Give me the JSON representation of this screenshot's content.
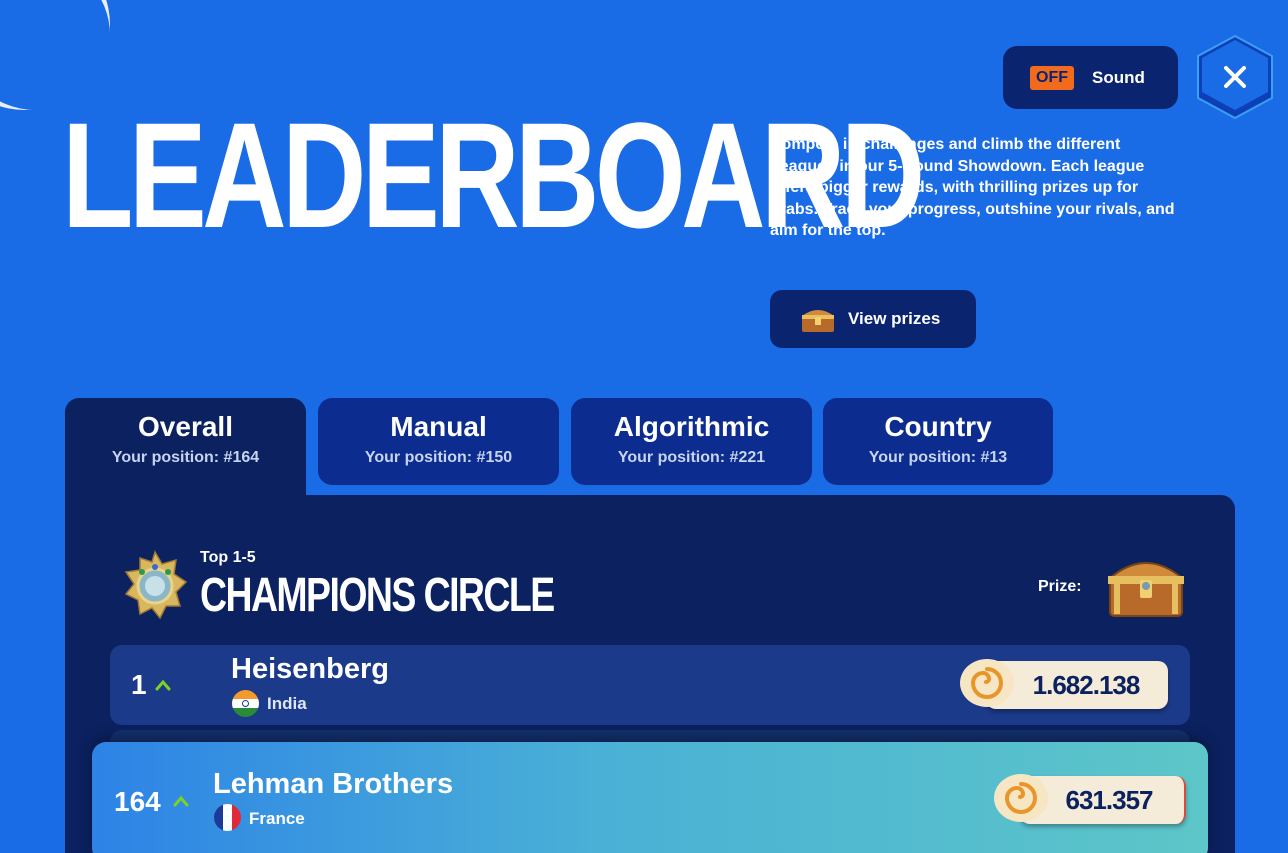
{
  "title": "LEADERBOARD",
  "sound": {
    "state": "OFF",
    "label": "Sound"
  },
  "description": "Compete in challenges and climb the different Leagues in our 5-Round Showdown. Each league offers bigger rewards, with thrilling prizes up for grabs. Track your progress, outshine your rivals, and aim for the top.",
  "prizes_button": "View prizes",
  "tabs": [
    {
      "title": "Overall",
      "sub": "Your position: #164"
    },
    {
      "title": "Manual",
      "sub": "Your position: #150"
    },
    {
      "title": "Algorithmic",
      "sub": "Your position: #221"
    },
    {
      "title": "Country",
      "sub": "Your position: #13"
    }
  ],
  "section": {
    "small": "Top 1-5",
    "title": "CHAMPIONS CIRCLE",
    "prize_label": "Prize:"
  },
  "rows": [
    {
      "rank": "1",
      "name": "Heisenberg",
      "country": "India",
      "score": "1.682.138"
    }
  ],
  "me": {
    "rank": "164",
    "name": "Lehman Brothers",
    "country": "France",
    "score": "631.357"
  },
  "colors": {
    "background": "#1a6be6",
    "panel": "#0b2160",
    "button": "#0b2470",
    "accent_off": "#f26b1d",
    "up_arrow": "#7ed321"
  }
}
